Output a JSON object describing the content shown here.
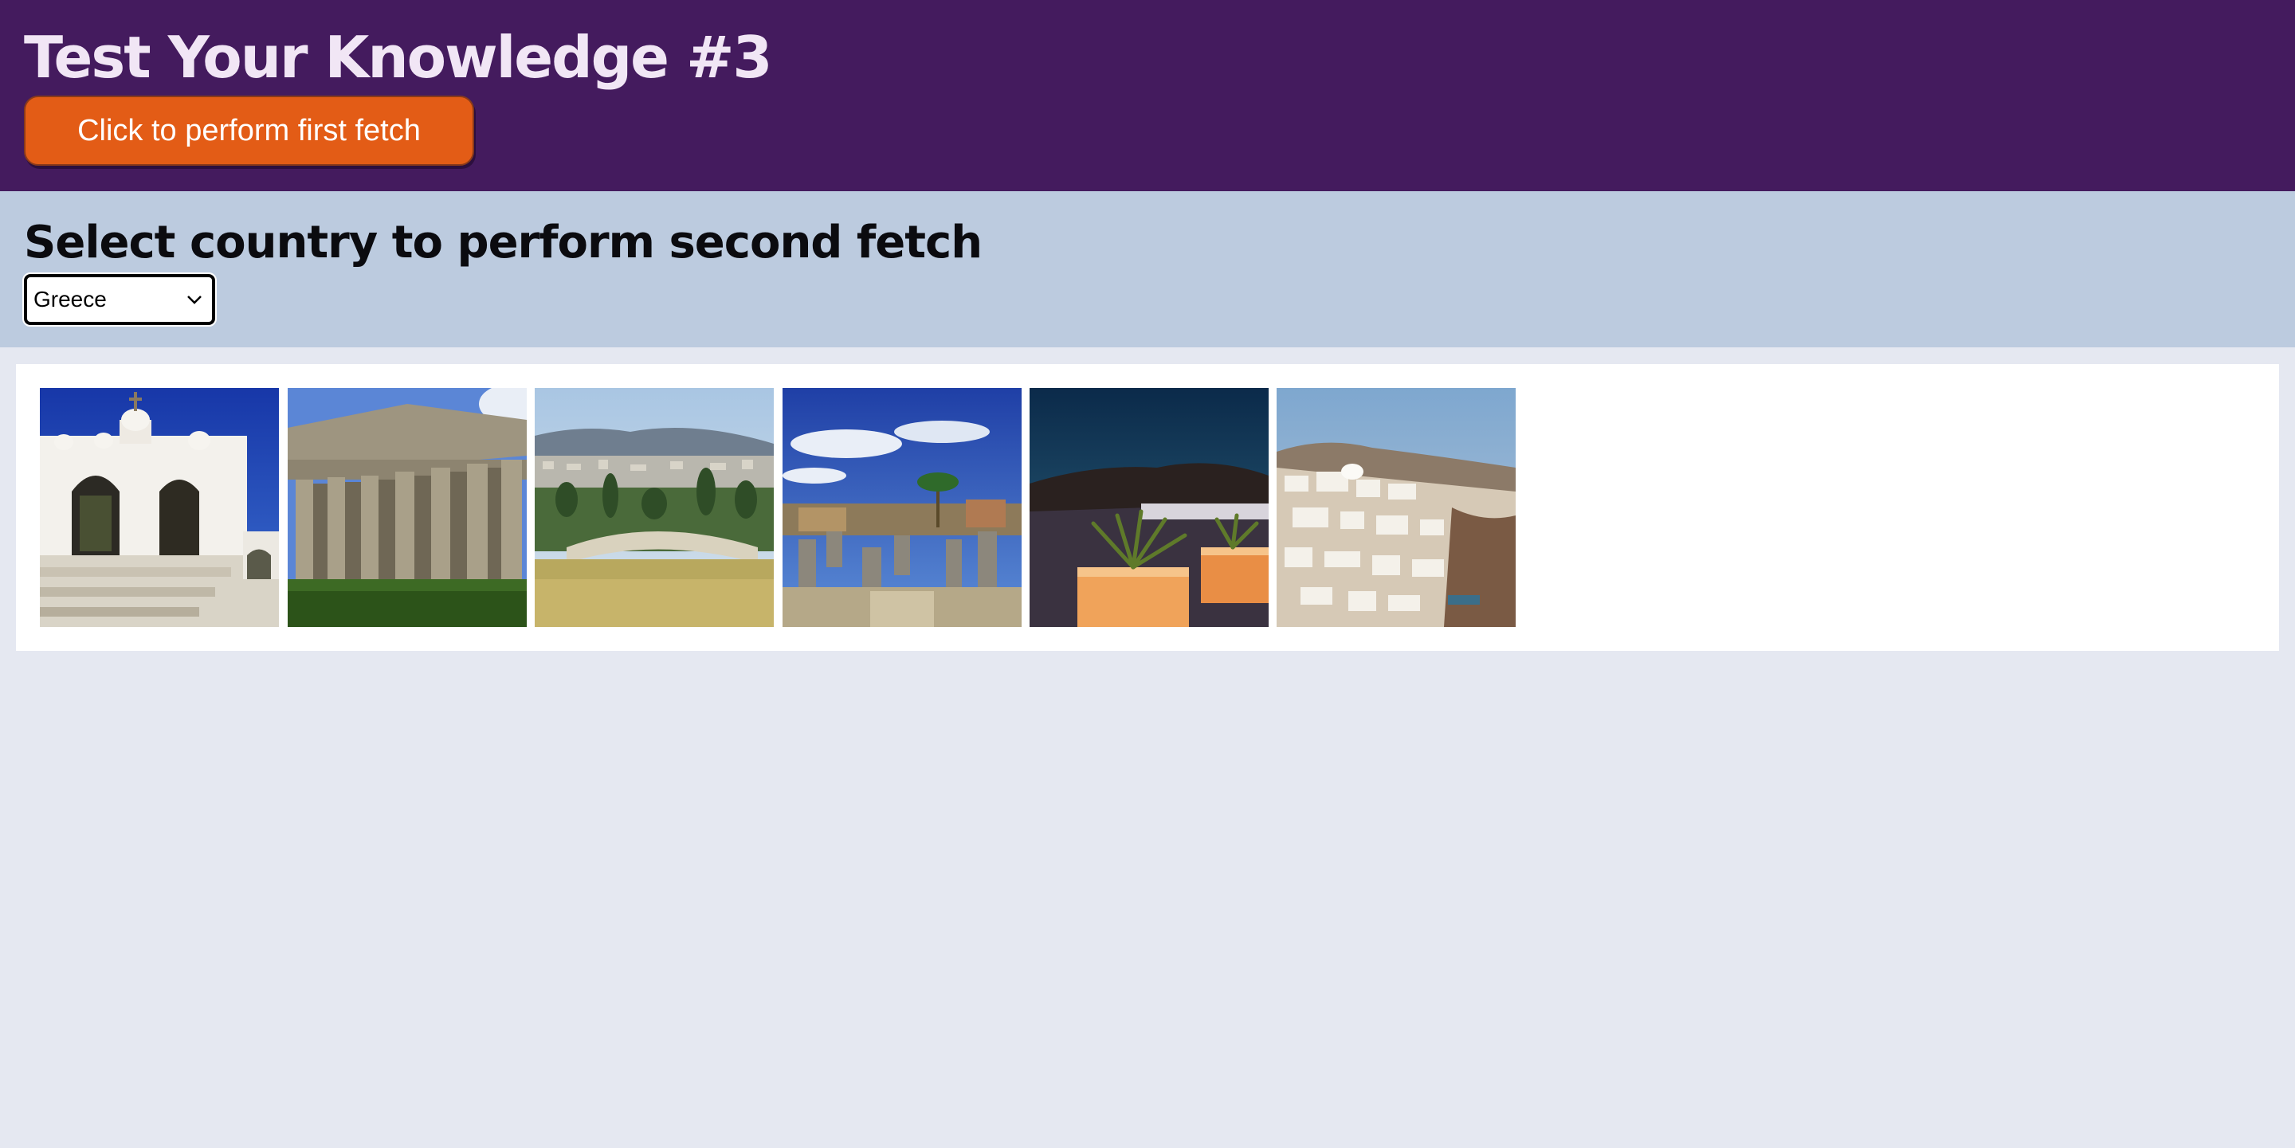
{
  "header": {
    "title": "Test Your Knowledge #3",
    "fetch_button_label": "Click to perform first fetch"
  },
  "country_section": {
    "title": "Select country to perform second fetch",
    "selected_country": "Greece"
  },
  "gallery": {
    "photos": [
      {
        "subject": "White chapel with bell arches"
      },
      {
        "subject": "Doric temple with columns"
      },
      {
        "subject": "Ancient theater overlooking city"
      },
      {
        "subject": "Column ruins under blue sky"
      },
      {
        "subject": "Terrace planters at sunset"
      },
      {
        "subject": "Whitewashed cliffside village"
      }
    ]
  },
  "colors": {
    "header_bg": "#441b5e",
    "button_bg": "#e35c16",
    "section_bg": "#bccbdf",
    "page_bg": "#e5e8f1"
  }
}
